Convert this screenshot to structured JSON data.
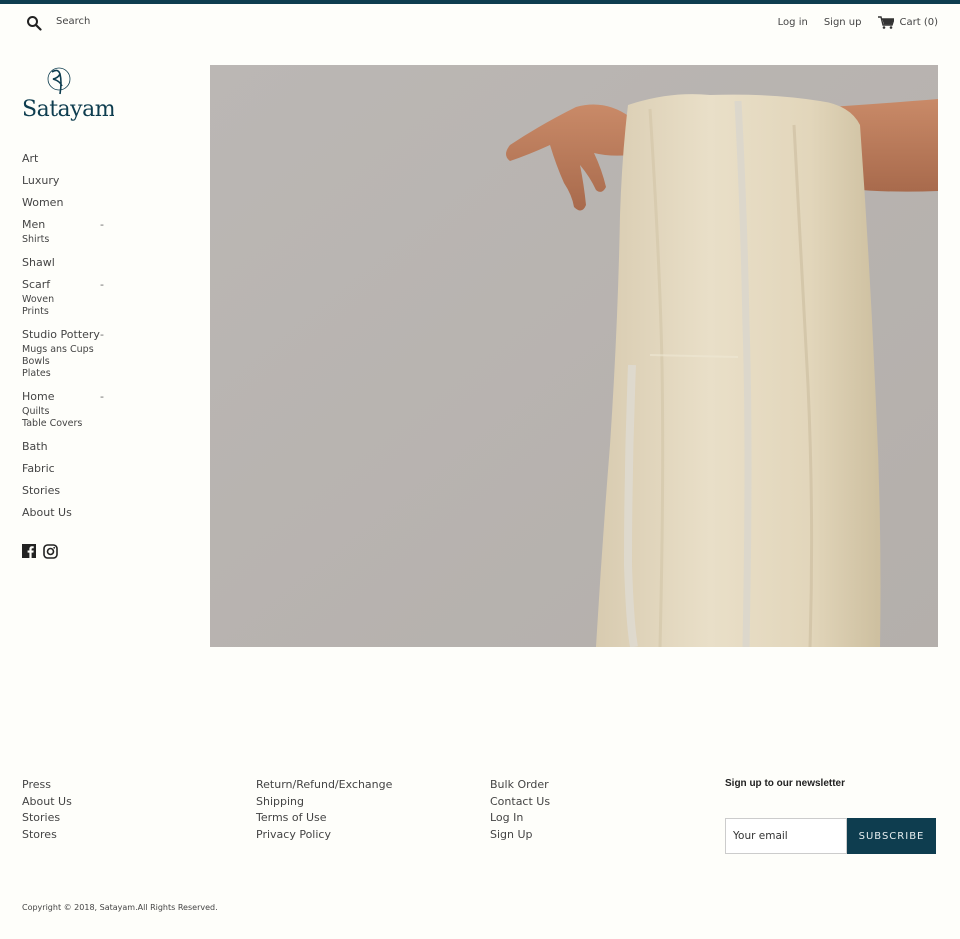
{
  "header": {
    "search_placeholder": "Search",
    "login": "Log in",
    "signup": "Sign up",
    "cart": "Cart (0)"
  },
  "brand": {
    "name": "Satayam",
    "accent": "#0e3d4f"
  },
  "sidebar": {
    "items": [
      {
        "label": "Art"
      },
      {
        "label": "Luxury"
      },
      {
        "label": "Women"
      },
      {
        "label": "Men",
        "toggle": "-",
        "children": [
          "Shirts"
        ]
      },
      {
        "label": "Shawl"
      },
      {
        "label": "Scarf",
        "toggle": "-",
        "children": [
          "Woven",
          "Prints"
        ]
      },
      {
        "label": "Studio Pottery",
        "toggle": "-",
        "children": [
          "Mugs ans Cups",
          "Bowls",
          "Plates"
        ]
      },
      {
        "label": "Home",
        "toggle": "-",
        "children": [
          "Quilts",
          "Table Covers"
        ]
      },
      {
        "label": "Bath"
      },
      {
        "label": "Fabric"
      },
      {
        "label": "Stories"
      },
      {
        "label": "About Us"
      }
    ],
    "social": [
      "facebook-icon",
      "instagram-icon"
    ]
  },
  "hero": {
    "image_alt": "Hand draped with cream shawl with silver stripe"
  },
  "footer": {
    "col1": [
      "Press",
      "About Us",
      "Stories",
      "Stores"
    ],
    "col2": [
      "Return/Refund/Exchange",
      "Shipping",
      "Terms of Use",
      "Privacy Policy"
    ],
    "col3": [
      "Bulk Order",
      "Contact Us",
      "Log In",
      "Sign Up"
    ],
    "newsletter": {
      "title": "Sign up to our newsletter",
      "placeholder": "Your email",
      "button": "SUBSCRIBE"
    },
    "copyright": "Copyright © 2018, Satayam.All Rights Reserved."
  }
}
